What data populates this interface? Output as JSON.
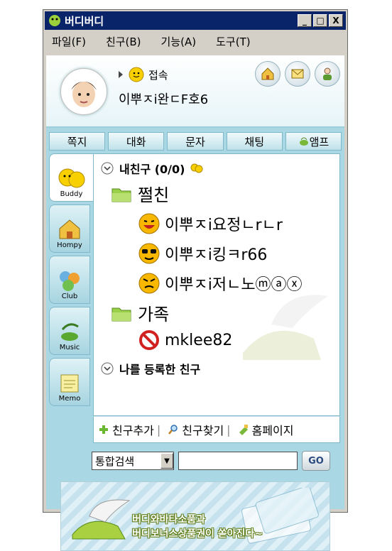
{
  "window": {
    "title": "버디버디",
    "buttons": [
      "_",
      "□",
      "X"
    ]
  },
  "menu": [
    "파일(F)",
    "친구(B)",
    "기능(A)",
    "도구(T)"
  ],
  "profile": {
    "status": "접속",
    "nickname": "이뿌ㅈi완ㄷF호6",
    "icons": [
      "home-icon",
      "mail-icon",
      "my-icon"
    ]
  },
  "tabs": [
    "쪽지",
    "대화",
    "문자",
    "채팅",
    "앰프"
  ],
  "sidebar": [
    {
      "label": "Buddy",
      "active": true
    },
    {
      "label": "Hompy"
    },
    {
      "label": "Club"
    },
    {
      "label": "Music"
    },
    {
      "label": "Memo"
    }
  ],
  "friends": {
    "header": "내친구 (0/0)",
    "groups": [
      {
        "name": "쩔친",
        "members": [
          {
            "name": "이뿌ㅈi요정ㄴrㄴr",
            "icon": "laughing-emoticon-icon"
          },
          {
            "name": "이뿌ㅈi킹ㅋr66",
            "icon": "sunglasses-emoticon-icon"
          },
          {
            "name": "이뿌ㅈi저ㄴ노ⓜⓐⓧ",
            "icon": "angry-emoticon-icon"
          }
        ]
      },
      {
        "name": "가족",
        "members": [
          {
            "name": "mklee82",
            "icon": "blocked-icon"
          }
        ]
      }
    ],
    "registered_header": "나를 등록한 친구"
  },
  "bottom_links": [
    "친구추가",
    "친구찾기",
    "홈페이지"
  ],
  "search": {
    "category": "통합검색",
    "value": "",
    "button": "GO"
  },
  "banner": {
    "line1": "버디와바타소품과",
    "line2": "버디보너스상품권이 쏟아진다~"
  }
}
